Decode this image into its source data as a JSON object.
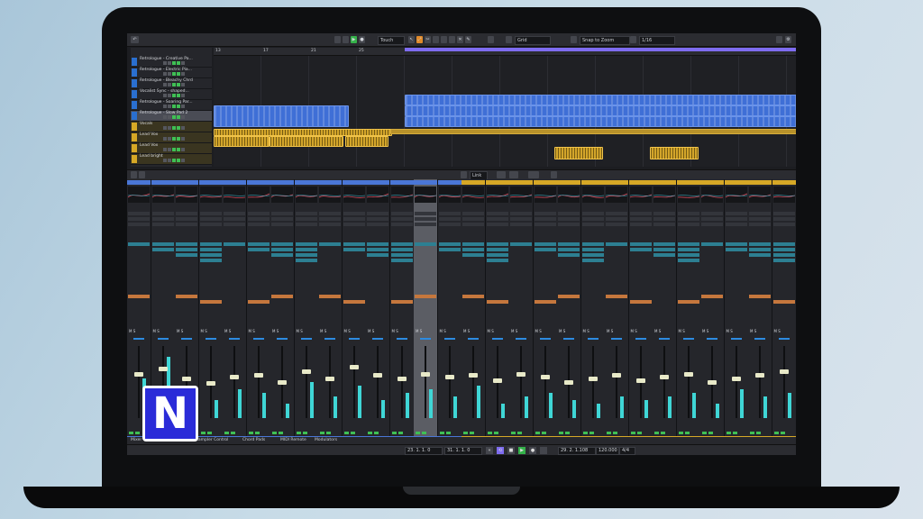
{
  "toolbar": {
    "mode_label": "Touch",
    "snap_label": "Grid",
    "quantize_label": "1/16",
    "snap_mode": "Snap to Zoom"
  },
  "ruler": {
    "bars": [
      "13",
      "17",
      "21",
      "25",
      "29",
      "33",
      "37",
      "41",
      "45",
      "49",
      "53",
      "57"
    ]
  },
  "tracks": [
    {
      "name": "Retrologue - Creative Pa...",
      "type": "instrument"
    },
    {
      "name": "Retrologue - Electric Pia...",
      "type": "instrument"
    },
    {
      "name": "Retrologue - Bleachy Chrd",
      "type": "instrument"
    },
    {
      "name": "Vocalist Sync - shaped...",
      "type": "instrument"
    },
    {
      "name": "Retrologue - Soaring Par...",
      "type": "instrument"
    },
    {
      "name": "Retrologue - Slow Pad 2",
      "type": "instrument",
      "selected": true
    },
    {
      "name": "Vocals",
      "type": "folder"
    },
    {
      "name": "Lead Vox",
      "type": "audio"
    },
    {
      "name": "Lead Vox",
      "type": "audio"
    },
    {
      "name": "Lead bright",
      "type": "audio"
    }
  ],
  "mixer": {
    "toolbar_label": "Link",
    "channels": [
      {
        "name": "Retrologue - Cr",
        "color": "blue",
        "meter": 0.55,
        "fader": 0.62
      },
      {
        "name": "Retrologue - Ele",
        "color": "blue",
        "meter": 0.85,
        "fader": 0.7
      },
      {
        "name": "Retrologue - Be",
        "color": "blue",
        "meter": 0.3,
        "fader": 0.55
      },
      {
        "name": "Retrologue - Soa",
        "color": "blue",
        "meter": 0.25,
        "fader": 0.48
      },
      {
        "name": "Retrologue - Slo",
        "color": "blue",
        "meter": 0.4,
        "fader": 0.58
      },
      {
        "name": "Retrologue - Ce",
        "color": "blue",
        "meter": 0.35,
        "fader": 0.6
      },
      {
        "name": "Retrologue - En",
        "color": "blue",
        "meter": 0.2,
        "fader": 0.5
      },
      {
        "name": "Retrologue - Soar",
        "color": "blue",
        "meter": 0.5,
        "fader": 0.65
      },
      {
        "name": "Retrologue - La",
        "color": "blue",
        "meter": 0.3,
        "fader": 0.55
      },
      {
        "name": "Retrologue - Hyb",
        "color": "blue",
        "meter": 0.45,
        "fader": 0.72
      },
      {
        "name": "Retrologue - Lst",
        "color": "blue",
        "meter": 0.25,
        "fader": 0.6
      },
      {
        "name": "Retrologue - Sha",
        "color": "blue",
        "meter": 0.35,
        "fader": 0.55
      },
      {
        "name": "Retrologue - Slo",
        "color": "blue",
        "meter": 0.4,
        "fader": 0.62,
        "selected": true
      },
      {
        "name": "Retrologue - Slo",
        "color": "blue",
        "meter": 0.3,
        "fader": 0.58
      },
      {
        "name": "Lead",
        "color": "yellow",
        "meter": 0.45,
        "fader": 0.6
      },
      {
        "name": "Lead Vox",
        "color": "yellow",
        "meter": 0.2,
        "fader": 0.52
      },
      {
        "name": "Lead bright",
        "color": "yellow",
        "meter": 0.3,
        "fader": 0.62
      },
      {
        "name": "Lead Percussion",
        "color": "yellow",
        "meter": 0.35,
        "fader": 0.58
      },
      {
        "name": "Vocoder FX",
        "color": "yellow",
        "meter": 0.25,
        "fader": 0.5
      },
      {
        "name": "Lead Reverb",
        "color": "yellow",
        "meter": 0.2,
        "fader": 0.55
      },
      {
        "name": "Dub",
        "color": "yellow",
        "meter": 0.3,
        "fader": 0.6
      },
      {
        "name": "Sniff",
        "color": "yellow",
        "meter": 0.25,
        "fader": 0.52
      },
      {
        "name": "Bell",
        "color": "yellow",
        "meter": 0.3,
        "fader": 0.58
      },
      {
        "name": "Dub",
        "color": "yellow",
        "meter": 0.35,
        "fader": 0.62
      },
      {
        "name": "Sniff",
        "color": "yellow",
        "meter": 0.2,
        "fader": 0.5
      },
      {
        "name": "Bell",
        "color": "yellow",
        "meter": 0.4,
        "fader": 0.55
      },
      {
        "name": "Stereo",
        "color": "yellow",
        "meter": 0.3,
        "fader": 0.6
      },
      {
        "name": "Stereo Light",
        "color": "yellow",
        "meter": 0.35,
        "fader": 0.65
      }
    ]
  },
  "zones": [
    "Mixer",
    "Sampler Control",
    "Chord Pads",
    "MIDI Remote",
    "Modulators"
  ],
  "transport": {
    "position_left": "23. 1. 1. 0",
    "position_right": "31. 1. 1. 0",
    "locator": "29. 2. 1.108",
    "tempo": "120.000",
    "signature": "4/4"
  }
}
